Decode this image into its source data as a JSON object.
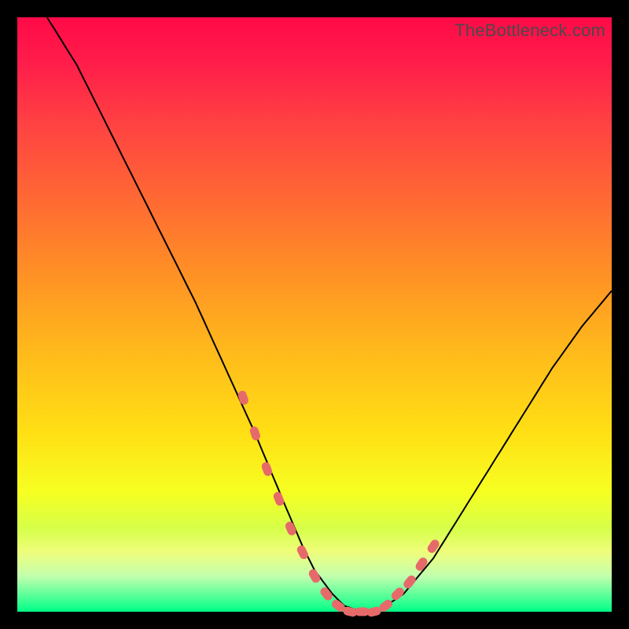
{
  "watermark": "TheBottleneck.com",
  "colors": {
    "background": "#000000",
    "curve": "#000000",
    "marker": "#e76a6a",
    "gradient_top": "#ff0a48",
    "gradient_bottom": "#00ff87"
  },
  "chart_data": {
    "type": "line",
    "title": "",
    "xlabel": "",
    "ylabel": "",
    "xlim": [
      0,
      100
    ],
    "ylim": [
      0,
      100
    ],
    "x": [
      5,
      10,
      15,
      20,
      25,
      30,
      35,
      40,
      45,
      48,
      50,
      53,
      55,
      58,
      60,
      62,
      65,
      70,
      75,
      80,
      85,
      90,
      95,
      100
    ],
    "values": [
      100,
      92,
      82,
      72,
      62,
      52,
      41,
      30,
      18,
      11,
      7,
      3,
      1,
      0,
      0,
      1,
      3,
      9,
      17,
      25,
      33,
      41,
      48,
      54
    ],
    "markers_x": [
      38,
      40,
      42,
      44,
      46,
      48,
      50,
      52,
      54,
      56,
      58,
      60,
      62,
      64,
      66,
      68,
      70
    ],
    "markers_y": [
      36,
      30,
      24,
      19,
      14,
      10,
      6,
      3,
      1,
      0,
      0,
      0,
      1,
      3,
      5,
      8,
      11
    ],
    "annotations": []
  }
}
